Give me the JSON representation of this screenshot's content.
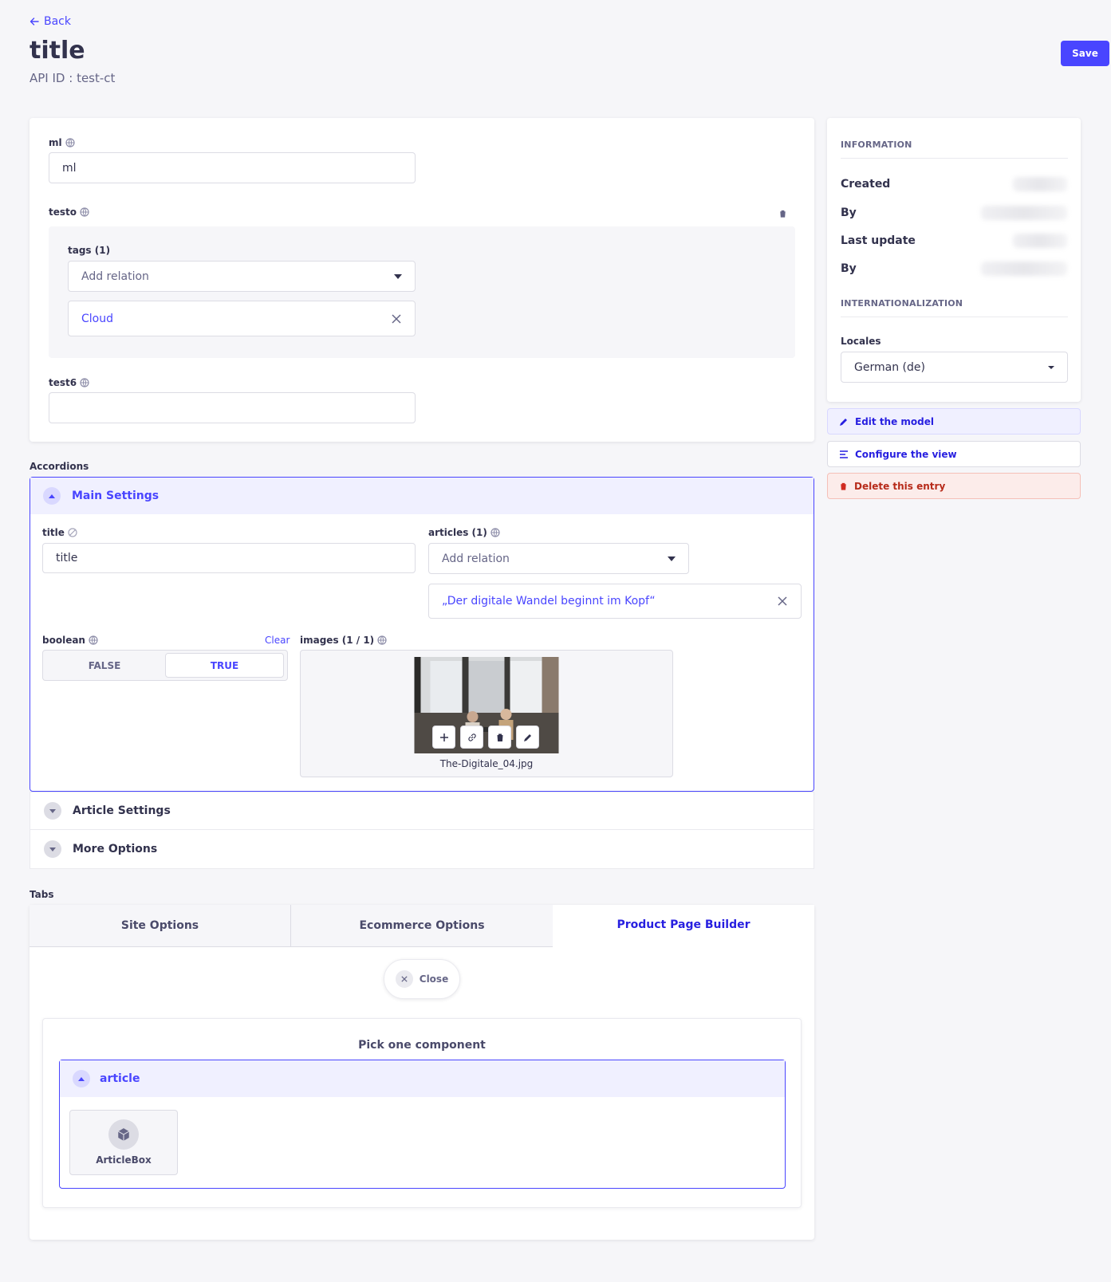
{
  "header": {
    "back_label": "Back",
    "title": "title",
    "api_id": "API ID : test-ct",
    "save_label": "Save"
  },
  "main_card": {
    "ml": {
      "label": "ml",
      "value": "ml"
    },
    "testo": {
      "label": "testo",
      "tags": {
        "label": "tags (1)",
        "placeholder": "Add relation",
        "items": [
          "Cloud"
        ]
      }
    },
    "test6": {
      "label": "test6",
      "value": ""
    }
  },
  "accordions": {
    "section_label": "Accordions",
    "main_settings": {
      "title": "Main Settings",
      "title_field": {
        "label": "title",
        "value": "title"
      },
      "articles": {
        "label": "articles (1)",
        "placeholder": "Add relation",
        "items": [
          "„Der digitale Wandel beginnt im Kopf“"
        ]
      },
      "boolean": {
        "label": "boolean",
        "clear_label": "Clear",
        "false_label": "FALSE",
        "true_label": "TRUE",
        "value": true
      },
      "images": {
        "label": "images (1 / 1)",
        "file_name": "The-Digitale_04.jpg"
      }
    },
    "article_settings": {
      "title": "Article Settings"
    },
    "more_options": {
      "title": "More Options"
    }
  },
  "tabs": {
    "section_label": "Tabs",
    "items": [
      "Site Options",
      "Ecommerce Options",
      "Product Page Builder"
    ],
    "active_index": 2,
    "close_label": "Close",
    "picker_title": "Pick one component",
    "category": "article",
    "components": [
      "ArticleBox"
    ]
  },
  "sidebar": {
    "information_heading": "INFORMATION",
    "rows": [
      "Created",
      "By",
      "Last update",
      "By"
    ],
    "i18n_heading": "INTERNATIONALIZATION",
    "locales_label": "Locales",
    "locale_value": "German (de)",
    "edit_model_label": "Edit the model",
    "configure_view_label": "Configure the view",
    "delete_label": "Delete this entry"
  },
  "colors": {
    "primary": "#4945ff",
    "danger": "#d02b20",
    "danger_bg": "#fcecea",
    "primary_bg": "#f0f0ff"
  }
}
